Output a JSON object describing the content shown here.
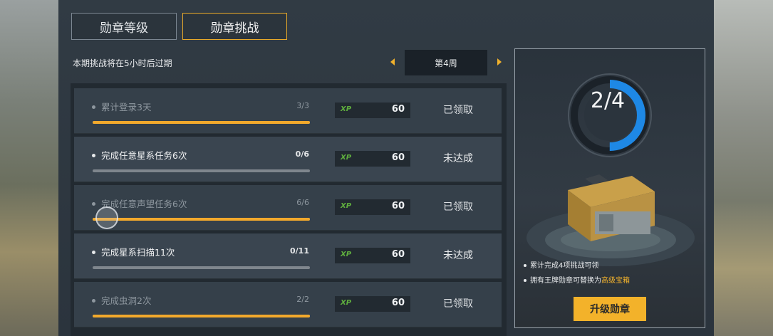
{
  "tabs": [
    {
      "label": "勋章等级",
      "active": false
    },
    {
      "label": "勋章挑战",
      "active": true
    }
  ],
  "expire_text": "本期挑战将在5小时后过期",
  "week_label": "第4周",
  "challenges": [
    {
      "title": "累计登录3天",
      "count": "3/3",
      "progress": 1.0,
      "xp_icon": "XP",
      "xp": "60",
      "status": "已领取"
    },
    {
      "title": "完成任意星系任务6次",
      "count": "0/6",
      "progress": 0.0,
      "xp_icon": "XP",
      "xp": "60",
      "status": "未达成"
    },
    {
      "title": "完成任意声望任务6次",
      "count": "6/6",
      "progress": 1.0,
      "xp_icon": "XP",
      "xp": "60",
      "status": "已领取"
    },
    {
      "title": "完成星系扫描11次",
      "count": "0/11",
      "progress": 0.0,
      "xp_icon": "XP",
      "xp": "60",
      "status": "未达成"
    },
    {
      "title": "完成虫洞2次",
      "count": "2/2",
      "progress": 1.0,
      "xp_icon": "XP",
      "xp": "60",
      "status": "已领取"
    }
  ],
  "reward": {
    "progress_text": "2/4",
    "progress_fraction": 0.5,
    "note1": "累计完成4项挑战可领",
    "note2_prefix": "拥有王牌勋章可替换为",
    "note2_highlight": "高级宝箱",
    "button_label": "升级勋章"
  },
  "colors": {
    "accent": "#f2a92c",
    "ring_blue": "#1e88e5",
    "xp_green": "#5fae3e"
  }
}
